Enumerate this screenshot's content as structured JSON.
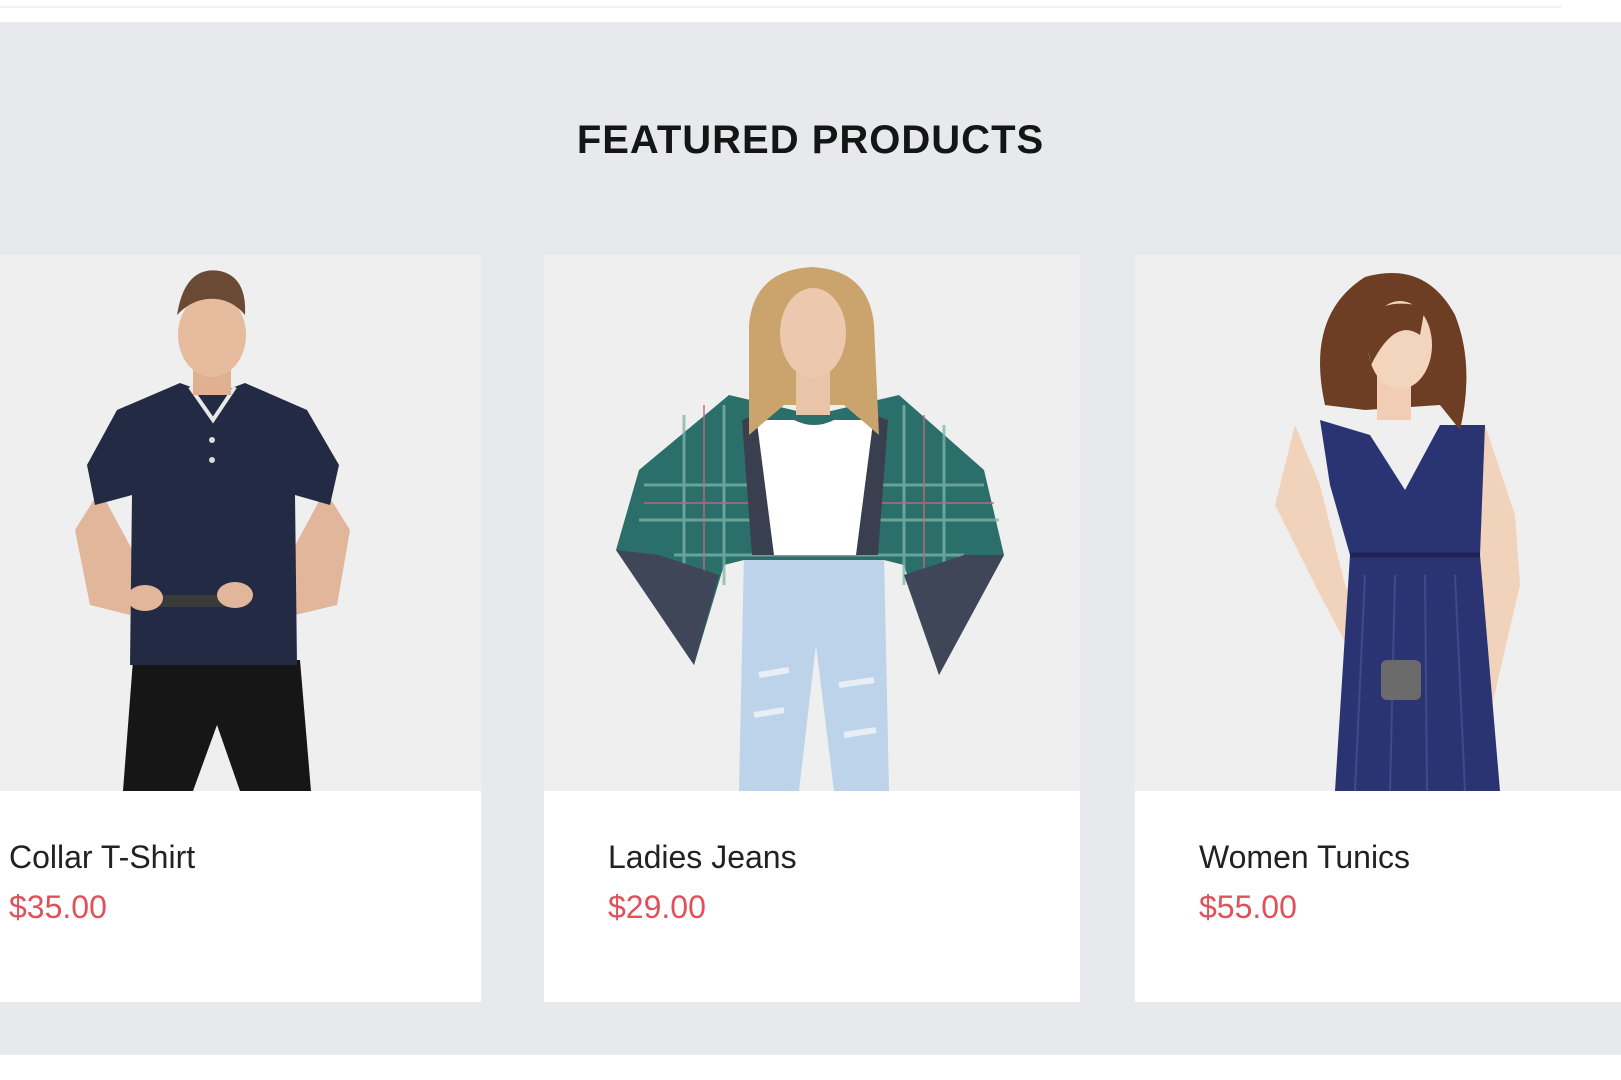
{
  "section": {
    "title": "FEATURED PRODUCTS"
  },
  "products": [
    {
      "name": "Collar T-Shirt",
      "price": "$35.00",
      "image_icon": "man-polo-shirt-photo"
    },
    {
      "name": "Ladies Jeans",
      "price": "$29.00",
      "image_icon": "woman-plaid-jacket-photo"
    },
    {
      "name": "Women Tunics",
      "price": "$55.00",
      "image_icon": "woman-navy-dress-photo"
    }
  ],
  "colors": {
    "background": "#e7e9ec",
    "card": "#ffffff",
    "image_bg": "#efefef",
    "price": "#e2505a",
    "text": "#222222"
  }
}
